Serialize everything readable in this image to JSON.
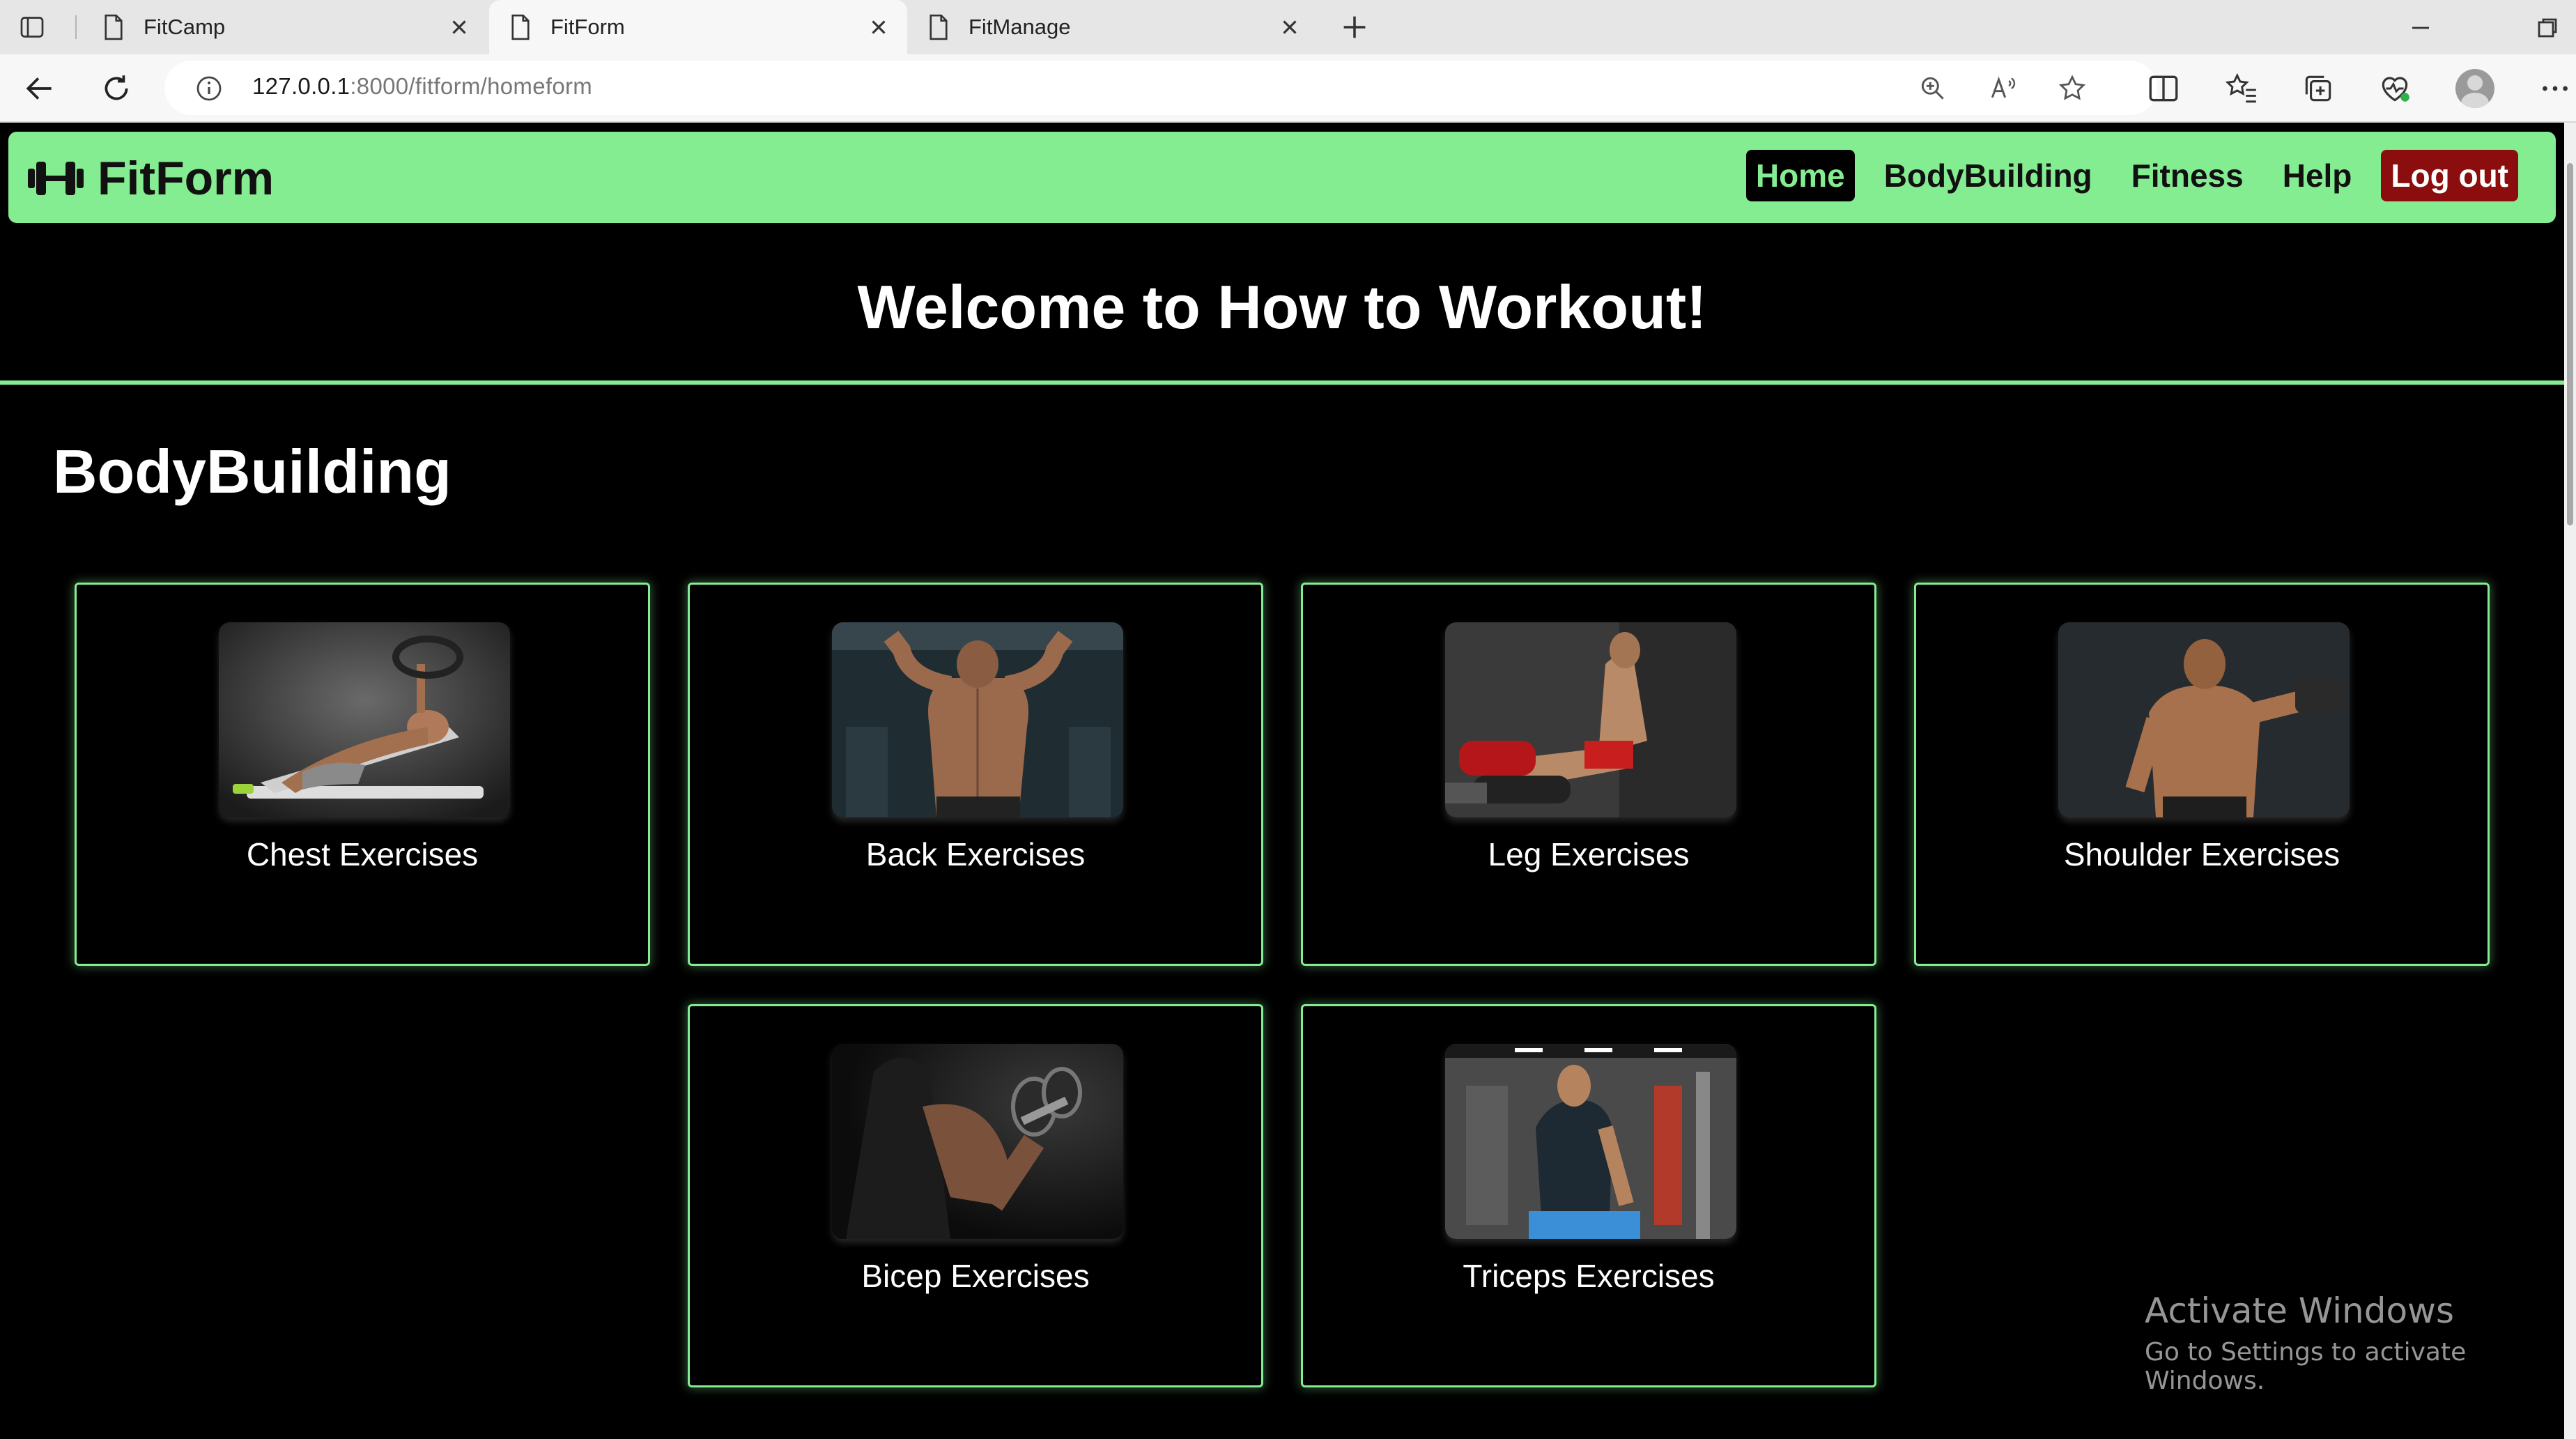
{
  "browser": {
    "tabs": [
      {
        "title": "FitCamp",
        "active": false
      },
      {
        "title": "FitForm",
        "active": true
      },
      {
        "title": "FitManage",
        "active": false
      }
    ],
    "url_host": "127.0.0.1",
    "url_rest": ":8000/fitform/homeform",
    "icons": [
      "sidebar-toggle-icon",
      "document-icon",
      "close-icon",
      "plus-icon",
      "minimize-icon",
      "restore-icon",
      "back-arrow-icon",
      "reload-icon",
      "info-icon",
      "zoom-icon",
      "read-aloud-icon",
      "favorite-star-icon",
      "split-screen-icon",
      "favorites-icon",
      "collections-icon",
      "browser-essentials-icon",
      "profile-avatar",
      "more-icon"
    ]
  },
  "navbar": {
    "brand": "FitForm",
    "brand_icon": "dumbbell-icon",
    "links": [
      "Home",
      "BodyBuilding",
      "Fitness",
      "Help",
      "Log out"
    ],
    "colors": {
      "bar": "#84ec91",
      "home_bg": "#000000",
      "logout_bg": "#8b0d0d"
    }
  },
  "welcome": "Welcome to How to Workout!",
  "section_title": "BodyBuilding",
  "cards": [
    {
      "label": "Chest Exercises",
      "image": "chest-exercise-photo"
    },
    {
      "label": "Back Exercises",
      "image": "back-exercise-photo"
    },
    {
      "label": "Leg Exercises",
      "image": "leg-exercise-photo"
    },
    {
      "label": "Shoulder Exercises",
      "image": "shoulder-exercise-photo"
    },
    {
      "label": "Bicep Exercises",
      "image": "bicep-exercise-photo"
    },
    {
      "label": "Triceps Exercises",
      "image": "triceps-exercise-photo"
    }
  ],
  "watermark": {
    "line1": "Activate Windows",
    "line2": "Go to Settings to activate Windows."
  }
}
